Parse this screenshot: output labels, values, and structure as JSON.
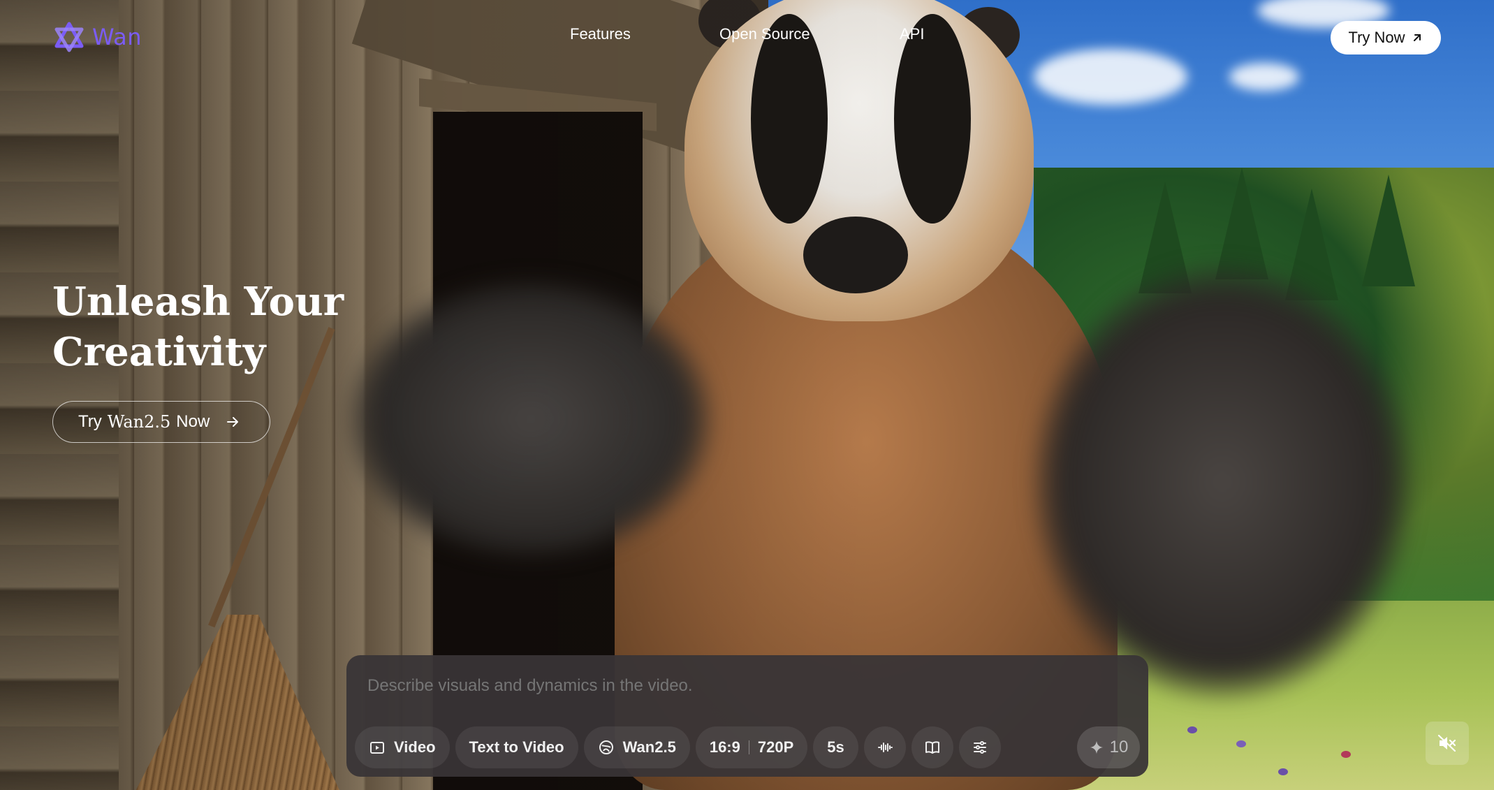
{
  "brand": {
    "logo_text": "Wan",
    "logo_color": "#7b5cf5"
  },
  "nav": {
    "items": [
      "Features",
      "Open Source",
      "API"
    ]
  },
  "header": {
    "try_now_label": "Try Now"
  },
  "hero": {
    "title_line1": "Unleash Your",
    "title_line2": "Creativity",
    "cta_prefix": "Try ",
    "cta_brand": "Wan2.5",
    "cta_suffix": " Now"
  },
  "prompt": {
    "placeholder": "Describe visuals and dynamics in the video.",
    "toolbar": {
      "mode_label": "Video",
      "task_label": "Text to Video",
      "model_label": "Wan2.5",
      "ratio_label": "16:9",
      "resolution_label": "720P",
      "duration_label": "5s",
      "credits_value": "10"
    }
  },
  "icons": {
    "logo": "wan-logo-icon",
    "arrow_upright": "arrow-up-right-icon",
    "arrow_right": "arrow-right-icon",
    "video": "video-play-icon",
    "model": "model-globe-icon",
    "audio": "audio-wave-icon",
    "book": "open-book-icon",
    "settings": "sliders-icon",
    "sparkle": "sparkle-icon",
    "mute": "speaker-muted-icon"
  }
}
